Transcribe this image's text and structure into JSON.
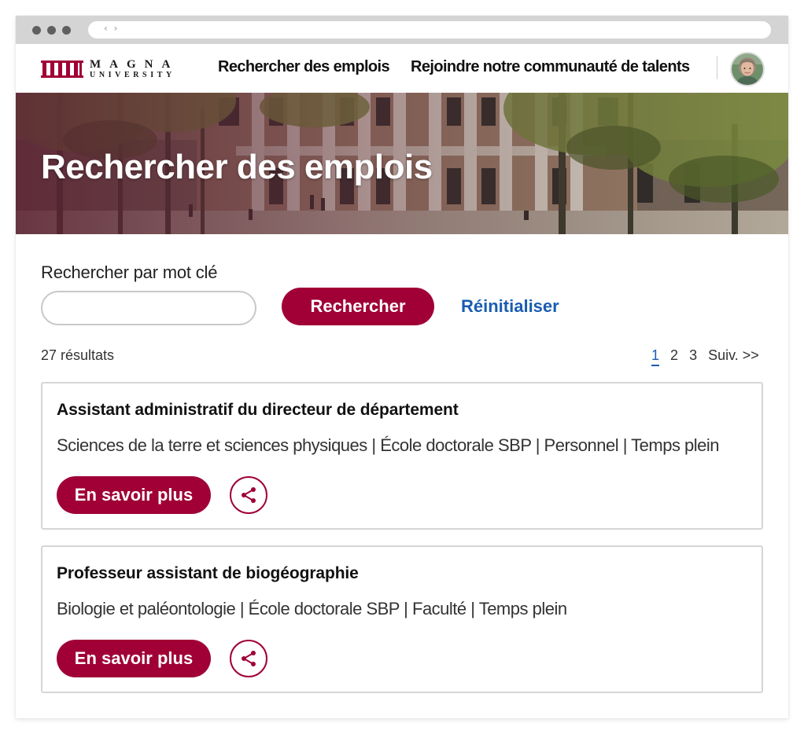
{
  "browser": {
    "nav_arrows": "‹ ›"
  },
  "header": {
    "logo": {
      "line1": "MAGNA",
      "line2": "UNIVERSITY",
      "color": "#a00036"
    },
    "nav": [
      {
        "label": "Rechercher des emplois"
      },
      {
        "label": "Rejoindre notre communauté de talents"
      }
    ],
    "avatar_icon": "user-avatar"
  },
  "hero": {
    "title": "Rechercher des emplois"
  },
  "search": {
    "label": "Rechercher par mot clé",
    "input_value": "",
    "button_label": "Rechercher",
    "reset_label": "Réinitialiser"
  },
  "results": {
    "count_text": "27 résultats",
    "pagination": {
      "pages": [
        "1",
        "2",
        "3"
      ],
      "current": "1",
      "next_label": "Suiv. >>"
    },
    "jobs": [
      {
        "title": "Assistant administratif du directeur de département",
        "meta": "Sciences de la terre et sciences physiques | École doctorale SBP | Personnel | Temps plein",
        "more_label": "En savoir plus",
        "share_icon": "share-icon"
      },
      {
        "title": "Professeur assistant de biogéographie",
        "meta": "Biologie et paléontologie | École doctorale SBP | Faculté | Temps plein",
        "more_label": "En savoir plus",
        "share_icon": "share-icon"
      }
    ]
  },
  "colors": {
    "brand": "#a00036",
    "link": "#1a5db0",
    "border": "#d6d6d6"
  }
}
